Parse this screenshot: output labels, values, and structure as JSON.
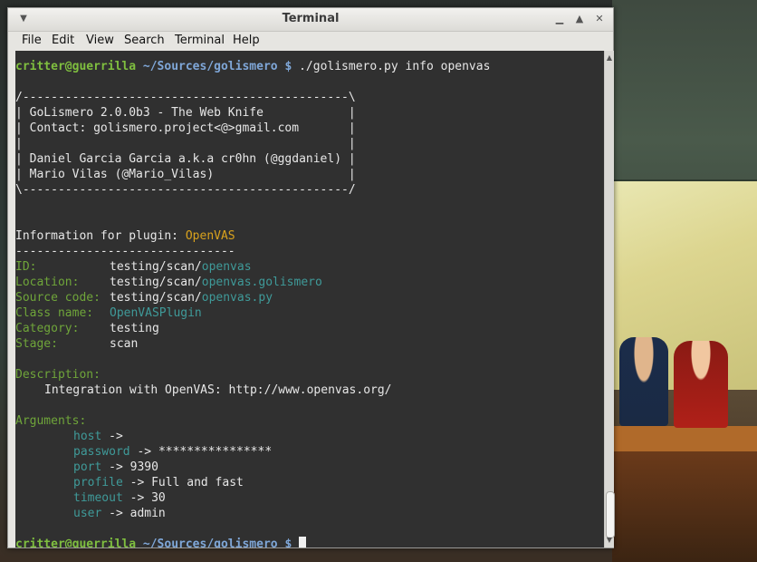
{
  "window": {
    "title": "Terminal",
    "menu": [
      "File",
      "Edit",
      "View",
      "Search",
      "Terminal",
      "Help"
    ],
    "controls": {
      "menu_icon": "window-menu-icon",
      "minimize": "minimize-icon",
      "maximize": "maximize-icon",
      "close": "close-icon"
    }
  },
  "prompt": {
    "user_host": "critter@guerrilla",
    "path": "~/Sources/golismero",
    "symbol": "$",
    "command": "./golismero.py info openvas"
  },
  "banner": [
    "/----------------------------------------------\\",
    "| GoLismero 2.0.0b3 - The Web Knife            |",
    "| Contact: golismero.project<@>gmail.com       |",
    "|                                              |",
    "| Daniel Garcia Garcia a.k.a cr0hn (@ggdaniel) |",
    "| Mario Vilas (@Mario_Vilas)                   |",
    "\\----------------------------------------------/"
  ],
  "info": {
    "heading": "Information for plugin: ",
    "plugin_name": "OpenVAS",
    "separator": "-------------------------------",
    "fields": {
      "id_label": "ID:",
      "id_prefix": "testing/scan/",
      "id_value": "openvas",
      "location_label": "Location:",
      "location_prefix": "testing/scan/",
      "location_value": "openvas.golismero",
      "source_label": "Source code:",
      "source_prefix": "testing/scan/",
      "source_value": "openvas.py",
      "class_label": "Class name:",
      "class_value": "OpenVASPlugin",
      "category_label": "Category:",
      "category_value": "testing",
      "stage_label": "Stage:",
      "stage_value": "scan"
    },
    "description_label": "Description:",
    "description_text": "Integration with OpenVAS: http://www.openvas.org/",
    "arguments_label": "Arguments:",
    "arguments": [
      {
        "name": "host",
        "value": ""
      },
      {
        "name": "password",
        "value": "****************"
      },
      {
        "name": "port",
        "value": "9390"
      },
      {
        "name": "profile",
        "value": "Full and fast"
      },
      {
        "name": "timeout",
        "value": "30"
      },
      {
        "name": "user",
        "value": "admin"
      }
    ],
    "arrow": "->"
  },
  "colors": {
    "terminal_bg": "#303030",
    "prompt_green": "#7fbf3f",
    "path_blue": "#7fa7d8",
    "label_green": "#6fa53a",
    "accent_orange": "#d9a21d",
    "value_cyan": "#3f9a99"
  }
}
